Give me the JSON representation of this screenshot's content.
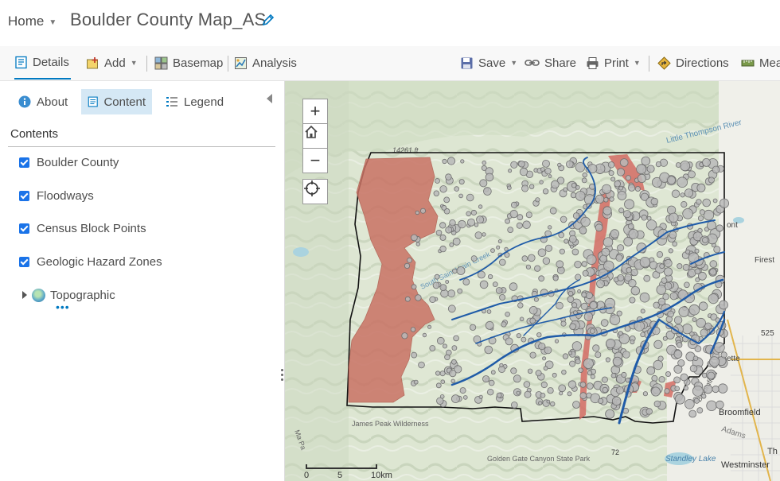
{
  "header": {
    "home_label": "Home",
    "map_title": "Boulder County Map_AS"
  },
  "toolbar": {
    "details": "Details",
    "add": "Add",
    "basemap": "Basemap",
    "analysis": "Analysis",
    "save": "Save",
    "share": "Share",
    "print": "Print",
    "directions": "Directions",
    "measure": "Mea"
  },
  "panel": {
    "tabs": [
      "About",
      "Content",
      "Legend"
    ],
    "contents_heading": "Contents",
    "layers": [
      "Boulder County",
      "Floodways",
      "Census Block Points",
      "Geologic Hazard Zones"
    ],
    "basemap": "Topographic"
  },
  "map": {
    "zoom_in": "+",
    "zoom_out": "−",
    "scale": {
      "labels": [
        "0",
        "5",
        "10km"
      ]
    },
    "labels": {
      "river": "Little Thompson River",
      "creek": "South Saint Vrain Creek",
      "elevation": "14261 ft",
      "east1": "ont",
      "east2": "Firest",
      "east3": "ette",
      "road": "525",
      "broomfield": "Broomfield",
      "adams": "Adams",
      "broomfield_road": "Broomfield",
      "wilderness": "James Peak Wilderness",
      "goldengate": "Golden Gate Canyon State Park",
      "standley": "Standley Lake",
      "westminster": "Westminster",
      "th": "Th",
      "hwy": "72",
      "mapleft": "Ma Pa"
    }
  },
  "colors": {
    "accent": "#0079c1",
    "hazard": "#c94a3d",
    "floodway": "#1f5ba8",
    "census": "#a8a8a8"
  }
}
